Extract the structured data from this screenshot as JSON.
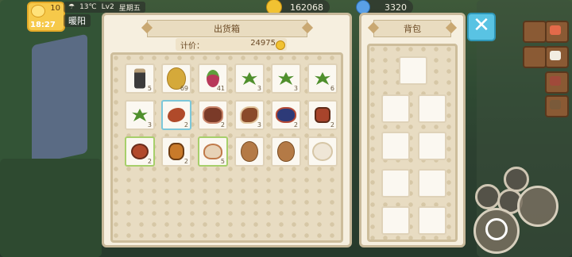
{
  "hud": {
    "day_number": "10",
    "time": "18:27",
    "temperature": "13℃",
    "level": "Lv2",
    "weekday": "星期五",
    "weather_icon": "cloud-rain",
    "player_name": "暖阳",
    "coins": "162068",
    "gems": "3320"
  },
  "shipping_box": {
    "title": "出货箱",
    "price_label": "计价：",
    "price_value": "24975",
    "items": [
      {
        "name": "jar-icon",
        "count": "5"
      },
      {
        "name": "potato-icon",
        "count": "69"
      },
      {
        "name": "radish-icon",
        "count": "41"
      },
      {
        "name": "herb-icon",
        "count": "3"
      },
      {
        "name": "herb-icon",
        "count": "3"
      },
      {
        "name": "herb-icon",
        "count": "6"
      },
      {
        "name": "herb-icon",
        "count": "3"
      },
      {
        "name": "shrimp-icon",
        "count": "2"
      },
      {
        "name": "meat-icon",
        "count": "2"
      },
      {
        "name": "fish-icon",
        "count": "3"
      },
      {
        "name": "crab-icon",
        "count": "2"
      },
      {
        "name": "nut-icon",
        "count": "2"
      },
      {
        "name": "mushroom-icon",
        "count": "2"
      },
      {
        "name": "cone-icon",
        "count": "2"
      },
      {
        "name": "clam-icon",
        "count": "5"
      },
      {
        "name": "egg-icon",
        "count": ""
      },
      {
        "name": "egg-icon",
        "count": ""
      },
      {
        "name": "cauliflower-icon",
        "count": ""
      }
    ]
  },
  "backpack": {
    "title": "背包",
    "slots": 9
  },
  "colors": {
    "panel_bg": "#f6efdf",
    "close_button": "#59c3e3",
    "selected_blue": "#7cc7d9",
    "selected_green": "#a7cf6b"
  }
}
